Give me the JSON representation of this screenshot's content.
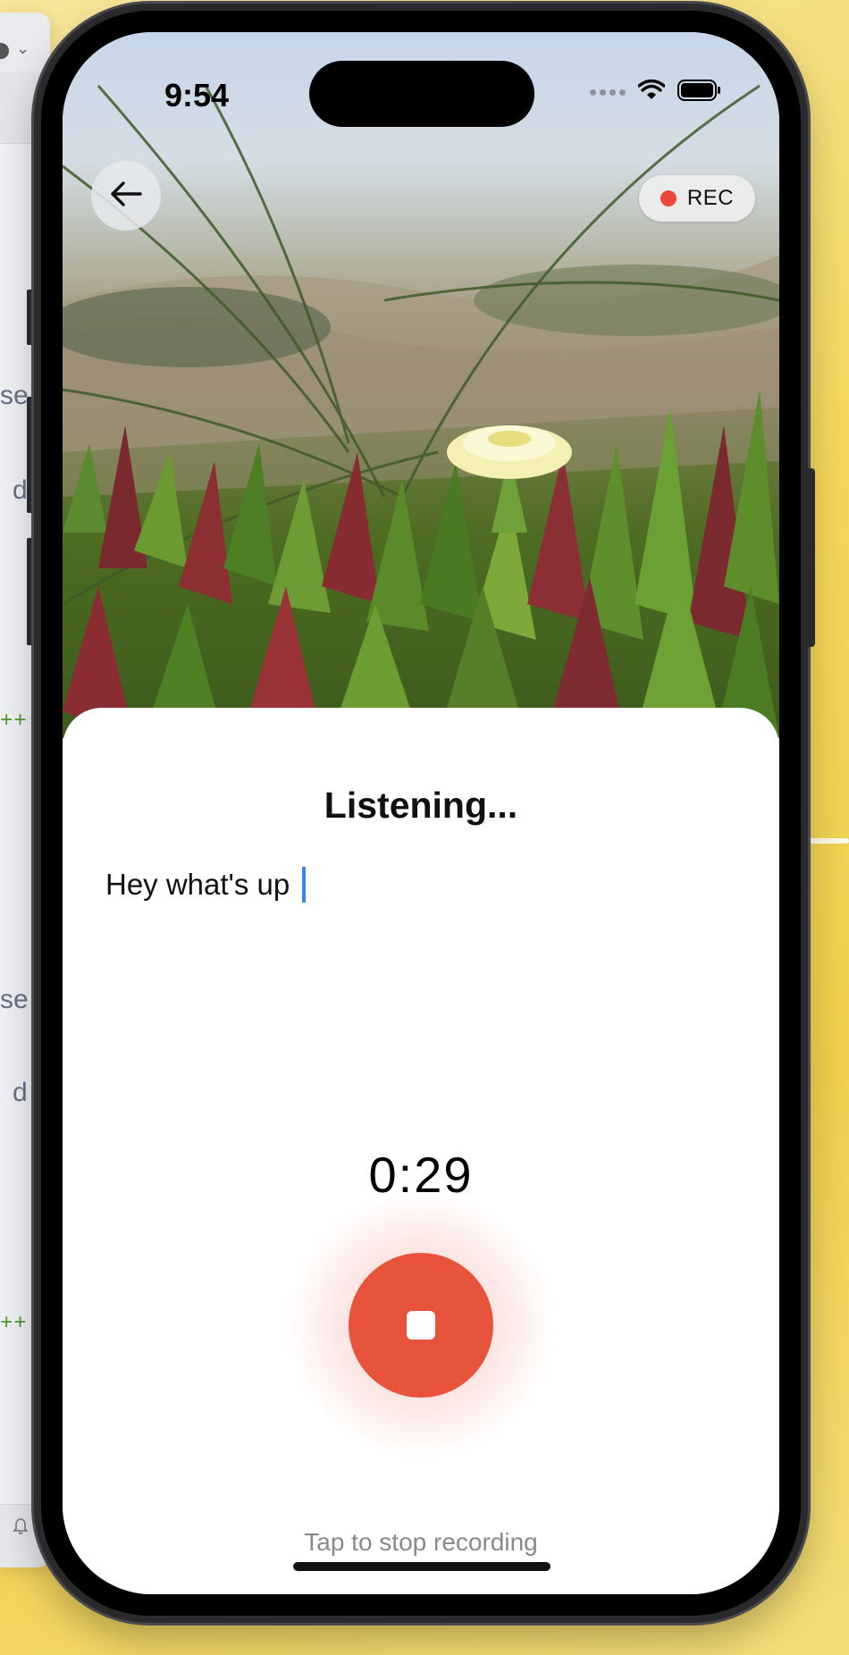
{
  "background_window": {
    "fragments": [
      "se",
      "d",
      "se",
      "d"
    ],
    "diff_markers": [
      "++",
      "++"
    ]
  },
  "status_bar": {
    "time": "9:54"
  },
  "header": {
    "back_icon": "arrow-left-icon",
    "rec_label": "REC",
    "rec_color": "#e8493a"
  },
  "sheet": {
    "title": "Listening...",
    "transcript": "Hey what's up",
    "timer": "0:29",
    "stop_icon": "stop-square-icon",
    "hint": "Tap to stop recording",
    "accent_color": "#e8533c",
    "caret_color": "#3b82f6"
  }
}
